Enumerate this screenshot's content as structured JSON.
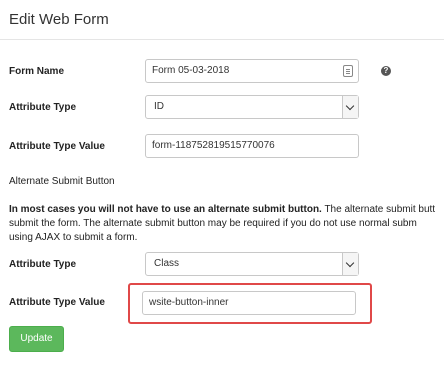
{
  "header": {
    "title": "Edit Web Form"
  },
  "form_name": {
    "label": "Form Name",
    "value": "Form 05-03-2018"
  },
  "attribute_type": {
    "label": "Attribute Type",
    "value": "ID"
  },
  "attribute_type_value": {
    "label": "Attribute Type Value",
    "value": "form-118752819515770076"
  },
  "alternate_submit": {
    "heading": "Alternate Submit Button",
    "lead_bold": "In most cases you will not have to use an alternate submit button.",
    "lead_rest": " The alternate submit butt",
    "line2": "submit the form. The alternate submit button may be required if you do not use normal subm",
    "line3": "using AJAX to submit a form."
  },
  "alt_attribute_type": {
    "label": "Attribute Type",
    "value": "Class"
  },
  "alt_attribute_type_value": {
    "label": "Attribute Type Value",
    "value": "wsite-button-inner"
  },
  "buttons": {
    "update_label": "Update"
  },
  "icons": {
    "help": "help-question-icon",
    "contact_card": "contact-card-icon",
    "chevron": "chevron-down-icon"
  },
  "colors": {
    "update_button": "#5cb85c",
    "highlight": "#e04848"
  }
}
